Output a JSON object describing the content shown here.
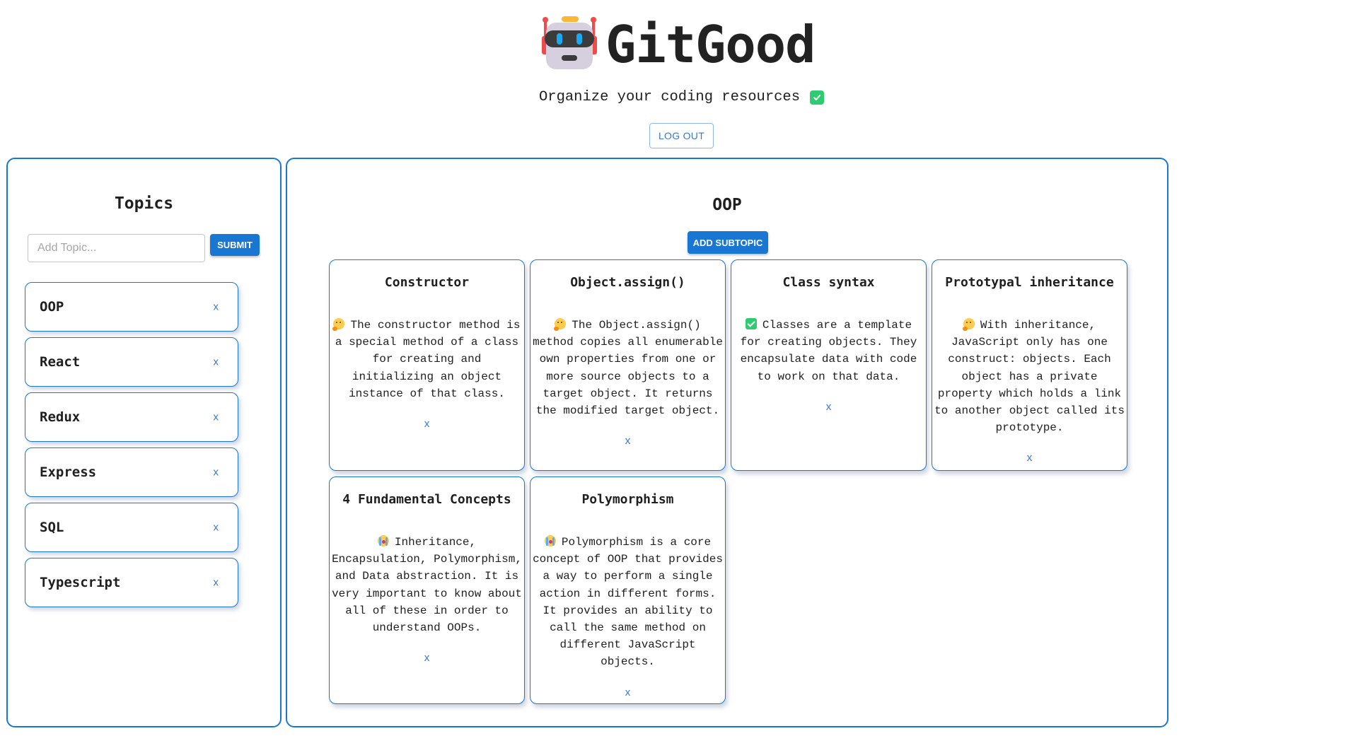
{
  "header": {
    "logo_icon": "robot-icon",
    "title": "GitGood",
    "subtitle": "Organize your coding resources",
    "subtitle_icon": "check-mark-button-icon",
    "logout_label": "LOG OUT"
  },
  "colors": {
    "accent": "#1976d2",
    "remove_link": "#3b78c9",
    "check_green": "#2ecc71"
  },
  "topics_panel": {
    "title": "Topics",
    "input_placeholder": "Add Topic...",
    "input_value": "",
    "submit_label": "SUBMIT",
    "remove_label": "x",
    "items": [
      {
        "label": "OOP"
      },
      {
        "label": "React"
      },
      {
        "label": "Redux"
      },
      {
        "label": "Express"
      },
      {
        "label": "SQL"
      },
      {
        "label": "Typescript"
      }
    ]
  },
  "main_panel": {
    "title": "OOP",
    "add_subtopic_label": "ADD SUBTOPIC",
    "remove_label": "x",
    "subtopics": [
      {
        "title": "Constructor",
        "emoji": "thinking-face-icon",
        "text": "The constructor method is a special method of a class for creating and initializing an object instance of that class."
      },
      {
        "title": "Object.assign()",
        "emoji": "thinking-face-icon",
        "text": "The Object.assign() method copies all enumerable own properties from one or more source objects to a target object. It returns the modified target object."
      },
      {
        "title": "Class syntax",
        "emoji": "check-mark-button-icon",
        "text": "Classes are a template for creating objects. They encapsulate data with code to work on that data."
      },
      {
        "title": "Prototypal inheritance",
        "emoji": "thinking-face-icon",
        "text": "With inheritance, JavaScript only has one construct: objects. Each object has a private property which holds a link to another object called its prototype."
      },
      {
        "title": "4 Fundamental Concepts",
        "emoji": "loudly-crying-face-icon",
        "text": "Inheritance, Encapsulation, Polymorphism, and Data abstraction. It is very important to know about all of these in order to understand OOPs."
      },
      {
        "title": "Polymorphism",
        "emoji": "loudly-crying-face-icon",
        "text": "Polymorphism is a core concept of OOP that provides a way to perform a single action in different forms. It provides an ability to call the same method on different JavaScript objects."
      }
    ]
  }
}
